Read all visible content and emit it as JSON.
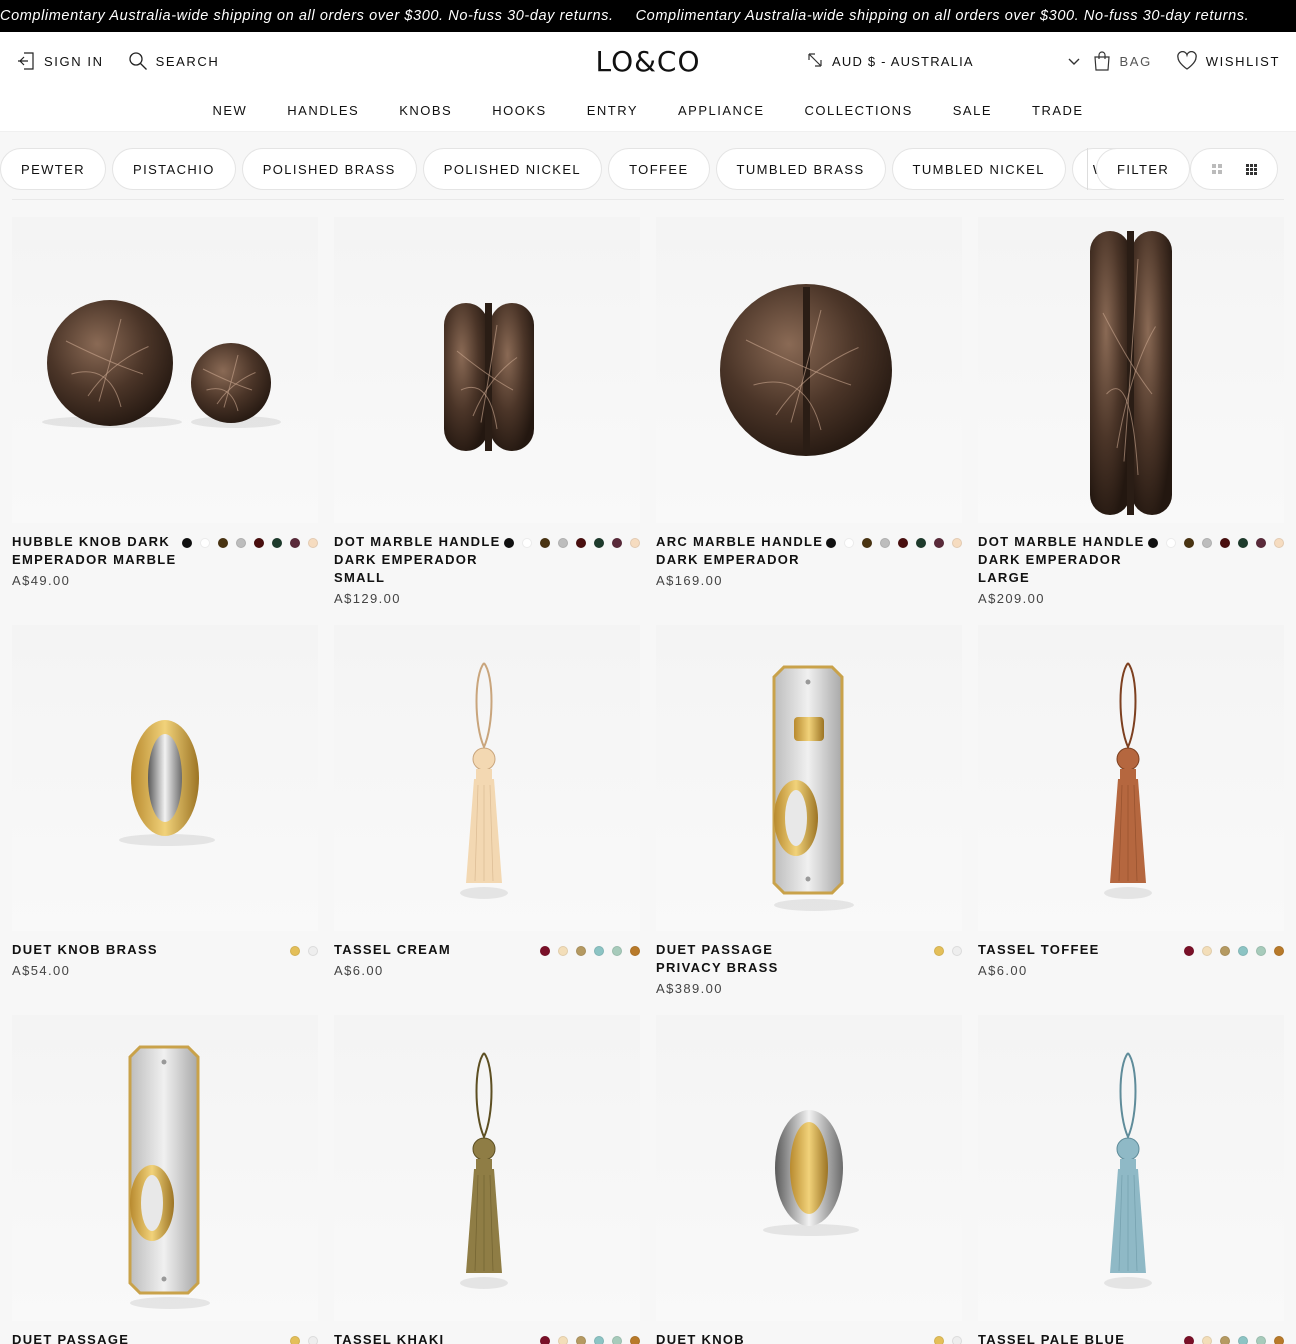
{
  "announcement": {
    "message": "Complimentary Australia-wide shipping on all orders over $300. No-fuss 30-day returns."
  },
  "header": {
    "sign_in": "SIGN IN",
    "search": "SEARCH",
    "logo": "LO&CO",
    "currency": "AUD $ - AUSTRALIA",
    "bag": "BAG",
    "wishlist": "WISHLIST"
  },
  "nav": [
    "NEW",
    "HANDLES",
    "KNOBS",
    "HOOKS",
    "ENTRY",
    "APPLIANCE",
    "COLLECTIONS",
    "SALE",
    "TRADE"
  ],
  "filters": {
    "chips": [
      "PEWTER",
      "PISTACHIO",
      "POLISHED BRASS",
      "POLISHED NICKEL",
      "TOFFEE",
      "TUMBLED BRASS",
      "TUMBLED NICKEL",
      "WHITE"
    ],
    "filter_label": "FILTER"
  },
  "colors": {
    "marble_swatches": [
      "#111111",
      "#ffffff",
      "#4a3412",
      "#bdbdbd",
      "#4a0f0f",
      "#1e3b2c",
      "#5a2a3a",
      "#f6dcc0"
    ],
    "duet_swatches": [
      "#e4bf59",
      "#eeeeee"
    ],
    "tassel_swatches": [
      "#7a1028",
      "#f3deb9",
      "#b59a62",
      "#8cc4c4",
      "#a7cbbb",
      "#b87a2a"
    ]
  },
  "products": [
    {
      "name": "HUBBLE KNOB DARK EMPERADOR MARBLE",
      "price": "A$49.00",
      "icon": "marble-spheres",
      "swatches": "marble"
    },
    {
      "name": "DOT MARBLE HANDLE DARK EMPERADOR SMALL",
      "price": "A$129.00",
      "icon": "marble-dot-handle-small",
      "swatches": "marble"
    },
    {
      "name": "ARC MARBLE HANDLE DARK EMPERADOR",
      "price": "A$169.00",
      "icon": "marble-arc-handle",
      "swatches": "marble"
    },
    {
      "name": "DOT MARBLE HANDLE DARK EMPERADOR LARGE",
      "price": "A$209.00",
      "icon": "marble-dot-handle-large",
      "swatches": "marble"
    },
    {
      "name": "DUET KNOB BRASS",
      "price": "A$54.00",
      "icon": "duet-knob-brass",
      "swatches": "duet"
    },
    {
      "name": "TASSEL CREAM",
      "price": "A$6.00",
      "icon": "tassel-cream",
      "swatches": "tassel"
    },
    {
      "name": "DUET PASSAGE PRIVACY BRASS",
      "price": "A$389.00",
      "icon": "duet-passage-privacy",
      "swatches": "duet"
    },
    {
      "name": "TASSEL TOFFEE",
      "price": "A$6.00",
      "icon": "tassel-toffee",
      "swatches": "tassel"
    },
    {
      "name": "DUET PASSAGE",
      "price": "",
      "icon": "duet-passage",
      "swatches": "duet"
    },
    {
      "name": "TASSEL KHAKI",
      "price": "",
      "icon": "tassel-khaki",
      "swatches": "tassel"
    },
    {
      "name": "DUET KNOB",
      "price": "",
      "icon": "duet-knob-nickel",
      "swatches": "duet"
    },
    {
      "name": "TASSEL PALE BLUE",
      "price": "",
      "icon": "tassel-pale-blue",
      "swatches": "tassel"
    }
  ]
}
